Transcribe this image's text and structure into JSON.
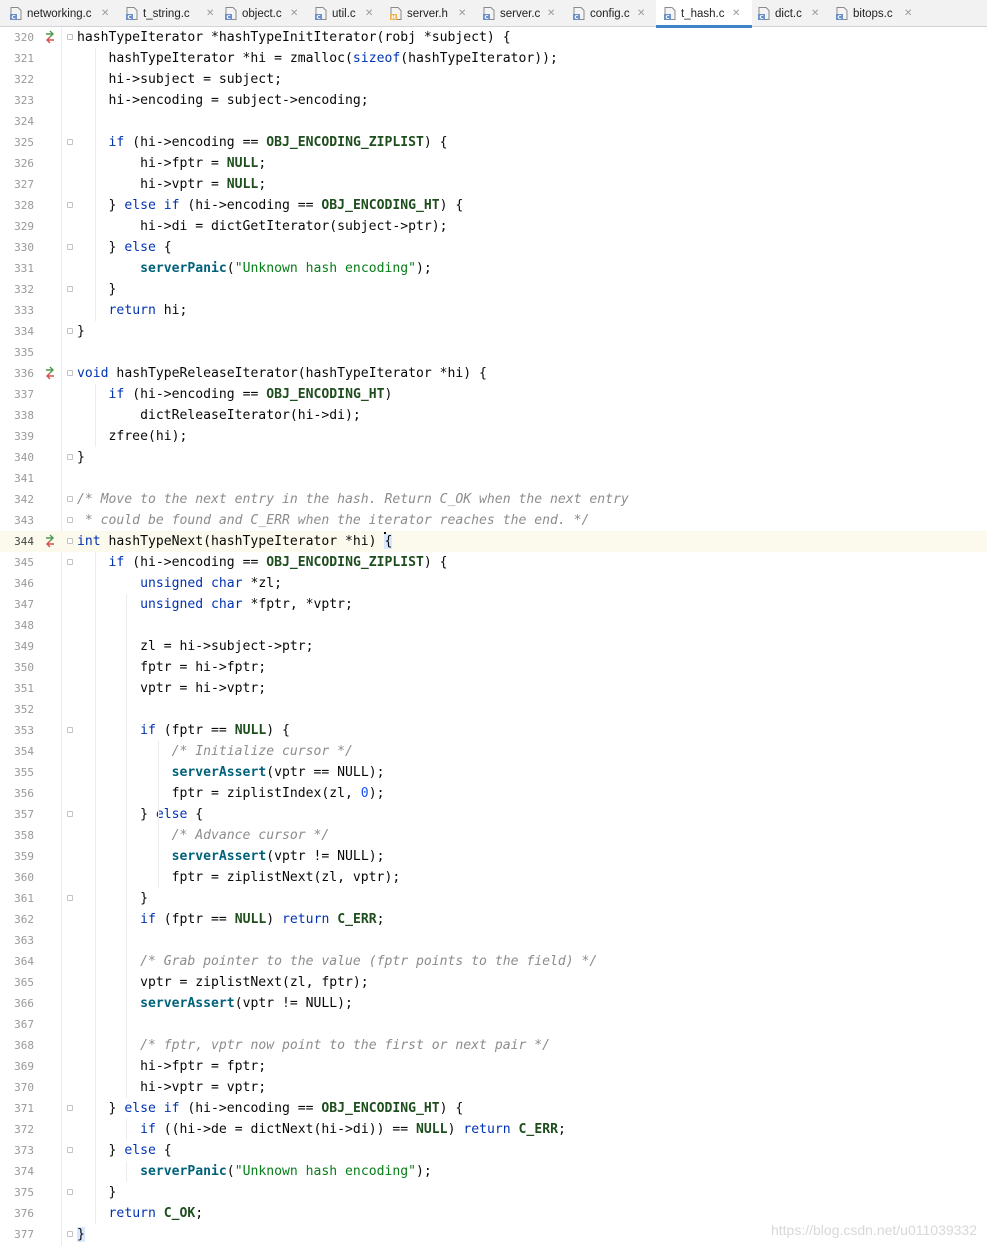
{
  "tabs": [
    {
      "label": "networking.c",
      "type": "c",
      "active": false
    },
    {
      "label": "t_string.c",
      "type": "c",
      "active": false
    },
    {
      "label": "object.c",
      "type": "c",
      "active": false
    },
    {
      "label": "util.c",
      "type": "c",
      "active": false
    },
    {
      "label": "server.h",
      "type": "h",
      "active": false
    },
    {
      "label": "server.c",
      "type": "c",
      "active": false
    },
    {
      "label": "config.c",
      "type": "c",
      "active": false
    },
    {
      "label": "t_hash.c",
      "type": "c",
      "active": true
    },
    {
      "label": "dict.c",
      "type": "c",
      "active": false
    },
    {
      "label": "bitops.c",
      "type": "c",
      "active": false
    }
  ],
  "editor": {
    "current_line": 344,
    "lines": [
      {
        "n": "320",
        "t": [
          [
            "t",
            "hashTypeIterator *hashTypeInitIterator(robj *subject) {"
          ]
        ]
      },
      {
        "n": "321",
        "t": [
          [
            "t",
            "    hashTypeIterator *hi = zmalloc("
          ],
          [
            "k",
            "sizeof"
          ],
          [
            "t",
            "(hashTypeIterator));"
          ]
        ]
      },
      {
        "n": "322",
        "t": [
          [
            "t",
            "    hi->subject = subject;"
          ]
        ]
      },
      {
        "n": "323",
        "t": [
          [
            "t",
            "    hi->encoding = subject->encoding;"
          ]
        ]
      },
      {
        "n": "324",
        "t": []
      },
      {
        "n": "325",
        "t": [
          [
            "t",
            "    "
          ],
          [
            "k",
            "if"
          ],
          [
            "t",
            " (hi->encoding == "
          ],
          [
            "m",
            "OBJ_ENCODING_ZIPLIST"
          ],
          [
            "t",
            ") {"
          ]
        ]
      },
      {
        "n": "326",
        "t": [
          [
            "t",
            "        hi->fptr = "
          ],
          [
            "m",
            "NULL"
          ],
          [
            "t",
            ";"
          ]
        ]
      },
      {
        "n": "327",
        "t": [
          [
            "t",
            "        hi->vptr = "
          ],
          [
            "m",
            "NULL"
          ],
          [
            "t",
            ";"
          ]
        ]
      },
      {
        "n": "328",
        "t": [
          [
            "t",
            "    } "
          ],
          [
            "k",
            "else if"
          ],
          [
            "t",
            " (hi->encoding == "
          ],
          [
            "m",
            "OBJ_ENCODING_HT"
          ],
          [
            "t",
            ") {"
          ]
        ]
      },
      {
        "n": "329",
        "t": [
          [
            "t",
            "        hi->di = dictGetIterator(subject->ptr);"
          ]
        ]
      },
      {
        "n": "330",
        "t": [
          [
            "t",
            "    } "
          ],
          [
            "k",
            "else"
          ],
          [
            "t",
            " {"
          ]
        ]
      },
      {
        "n": "331",
        "t": [
          [
            "t",
            "        "
          ],
          [
            "f",
            "serverPanic"
          ],
          [
            "t",
            "("
          ],
          [
            "s",
            "\"Unknown hash encoding\""
          ],
          [
            "t",
            ");"
          ]
        ]
      },
      {
        "n": "332",
        "t": [
          [
            "t",
            "    }"
          ]
        ]
      },
      {
        "n": "333",
        "t": [
          [
            "t",
            "    "
          ],
          [
            "k",
            "return"
          ],
          [
            "t",
            " hi;"
          ]
        ]
      },
      {
        "n": "334",
        "t": [
          [
            "t",
            "}"
          ]
        ]
      },
      {
        "n": "335",
        "t": []
      },
      {
        "n": "336",
        "t": [
          [
            "k",
            "void"
          ],
          [
            "t",
            " hashTypeReleaseIterator(hashTypeIterator *hi) {"
          ]
        ]
      },
      {
        "n": "337",
        "t": [
          [
            "t",
            "    "
          ],
          [
            "k",
            "if"
          ],
          [
            "t",
            " (hi->encoding == "
          ],
          [
            "m",
            "OBJ_ENCODING_HT"
          ],
          [
            "t",
            ")"
          ]
        ]
      },
      {
        "n": "338",
        "t": [
          [
            "t",
            "        dictReleaseIterator(hi->di);"
          ]
        ]
      },
      {
        "n": "339",
        "t": [
          [
            "t",
            "    zfree(hi);"
          ]
        ]
      },
      {
        "n": "340",
        "t": [
          [
            "t",
            "}"
          ]
        ]
      },
      {
        "n": "341",
        "t": []
      },
      {
        "n": "342",
        "t": [
          [
            "c",
            "/* Move to the next entry in the hash. Return C_OK when the next entry"
          ]
        ]
      },
      {
        "n": "343",
        "t": [
          [
            "c",
            " * could be found and C_ERR when the iterator reaches the end. */"
          ]
        ]
      },
      {
        "n": "344",
        "t": [
          [
            "k",
            "int"
          ],
          [
            "t",
            " hashTypeNext(hashTypeIterator *hi) "
          ],
          [
            "b",
            "{"
          ]
        ]
      },
      {
        "n": "345",
        "t": [
          [
            "t",
            "    "
          ],
          [
            "k",
            "if"
          ],
          [
            "t",
            " (hi->encoding == "
          ],
          [
            "m",
            "OBJ_ENCODING_ZIPLIST"
          ],
          [
            "t",
            ") {"
          ]
        ]
      },
      {
        "n": "346",
        "t": [
          [
            "t",
            "        "
          ],
          [
            "k",
            "unsigned char"
          ],
          [
            "t",
            " *zl;"
          ]
        ]
      },
      {
        "n": "347",
        "t": [
          [
            "t",
            "        "
          ],
          [
            "k",
            "unsigned char"
          ],
          [
            "t",
            " *fptr, *vptr;"
          ]
        ]
      },
      {
        "n": "348",
        "t": []
      },
      {
        "n": "349",
        "t": [
          [
            "t",
            "        zl = hi->subject->ptr;"
          ]
        ]
      },
      {
        "n": "350",
        "t": [
          [
            "t",
            "        fptr = hi->fptr;"
          ]
        ]
      },
      {
        "n": "351",
        "t": [
          [
            "t",
            "        vptr = hi->vptr;"
          ]
        ]
      },
      {
        "n": "352",
        "t": []
      },
      {
        "n": "353",
        "t": [
          [
            "t",
            "        "
          ],
          [
            "k",
            "if"
          ],
          [
            "t",
            " (fptr == "
          ],
          [
            "m",
            "NULL"
          ],
          [
            "t",
            ") {"
          ]
        ]
      },
      {
        "n": "354",
        "t": [
          [
            "t",
            "            "
          ],
          [
            "c",
            "/* Initialize cursor */"
          ]
        ]
      },
      {
        "n": "355",
        "t": [
          [
            "t",
            "            "
          ],
          [
            "f",
            "serverAssert"
          ],
          [
            "t",
            "(vptr == NULL);"
          ]
        ]
      },
      {
        "n": "356",
        "t": [
          [
            "t",
            "            fptr = ziplistIndex(zl, "
          ],
          [
            "n",
            "0"
          ],
          [
            "t",
            ");"
          ]
        ]
      },
      {
        "n": "357",
        "t": [
          [
            "t",
            "        } "
          ],
          [
            "k",
            "else"
          ],
          [
            "t",
            " {"
          ]
        ]
      },
      {
        "n": "358",
        "t": [
          [
            "t",
            "            "
          ],
          [
            "c",
            "/* Advance cursor */"
          ]
        ]
      },
      {
        "n": "359",
        "t": [
          [
            "t",
            "            "
          ],
          [
            "f",
            "serverAssert"
          ],
          [
            "t",
            "(vptr != NULL);"
          ]
        ]
      },
      {
        "n": "360",
        "t": [
          [
            "t",
            "            fptr = ziplistNext(zl, vptr);"
          ]
        ]
      },
      {
        "n": "361",
        "t": [
          [
            "t",
            "        }"
          ]
        ]
      },
      {
        "n": "362",
        "t": [
          [
            "t",
            "        "
          ],
          [
            "k",
            "if"
          ],
          [
            "t",
            " (fptr == "
          ],
          [
            "m",
            "NULL"
          ],
          [
            "t",
            ") "
          ],
          [
            "k",
            "return"
          ],
          [
            "t",
            " "
          ],
          [
            "m",
            "C_ERR"
          ],
          [
            "t",
            ";"
          ]
        ]
      },
      {
        "n": "363",
        "t": []
      },
      {
        "n": "364",
        "t": [
          [
            "t",
            "        "
          ],
          [
            "c",
            "/* Grab pointer to the value (fptr points to the field) */"
          ]
        ]
      },
      {
        "n": "365",
        "t": [
          [
            "t",
            "        vptr = ziplistNext(zl, fptr);"
          ]
        ]
      },
      {
        "n": "366",
        "t": [
          [
            "t",
            "        "
          ],
          [
            "f",
            "serverAssert"
          ],
          [
            "t",
            "(vptr != NULL);"
          ]
        ]
      },
      {
        "n": "367",
        "t": []
      },
      {
        "n": "368",
        "t": [
          [
            "t",
            "        "
          ],
          [
            "c",
            "/* fptr, vptr now point to the first or next pair */"
          ]
        ]
      },
      {
        "n": "369",
        "t": [
          [
            "t",
            "        hi->fptr = fptr;"
          ]
        ]
      },
      {
        "n": "370",
        "t": [
          [
            "t",
            "        hi->vptr = vptr;"
          ]
        ]
      },
      {
        "n": "371",
        "t": [
          [
            "t",
            "    } "
          ],
          [
            "k",
            "else if"
          ],
          [
            "t",
            " (hi->encoding == "
          ],
          [
            "m",
            "OBJ_ENCODING_HT"
          ],
          [
            "t",
            ") {"
          ]
        ]
      },
      {
        "n": "372",
        "t": [
          [
            "t",
            "        "
          ],
          [
            "k",
            "if"
          ],
          [
            "t",
            " ((hi->de = dictNext(hi->di)) == "
          ],
          [
            "m",
            "NULL"
          ],
          [
            "t",
            ") "
          ],
          [
            "k",
            "return"
          ],
          [
            "t",
            " "
          ],
          [
            "m",
            "C_ERR"
          ],
          [
            "t",
            ";"
          ]
        ]
      },
      {
        "n": "373",
        "t": [
          [
            "t",
            "    } "
          ],
          [
            "k",
            "else"
          ],
          [
            "t",
            " {"
          ]
        ]
      },
      {
        "n": "374",
        "t": [
          [
            "t",
            "        "
          ],
          [
            "f",
            "serverPanic"
          ],
          [
            "t",
            "("
          ],
          [
            "s",
            "\"Unknown hash encoding\""
          ],
          [
            "t",
            ");"
          ]
        ]
      },
      {
        "n": "375",
        "t": [
          [
            "t",
            "    }"
          ]
        ]
      },
      {
        "n": "376",
        "t": [
          [
            "t",
            "    "
          ],
          [
            "k",
            "return"
          ],
          [
            "t",
            " "
          ],
          [
            "m",
            "C_OK"
          ],
          [
            "t",
            ";"
          ]
        ]
      },
      {
        "n": "377",
        "t": [
          [
            "b",
            "}"
          ]
        ]
      }
    ],
    "change_marker_lines": [
      "320",
      "336",
      "344"
    ],
    "fold_lines": [
      "320",
      "325",
      "328",
      "330",
      "332",
      "334",
      "336",
      "340",
      "342",
      "343",
      "344",
      "345",
      "353",
      "357",
      "361",
      "371",
      "373",
      "375",
      "377"
    ]
  },
  "watermark": "https://blog.csdn.net/u011039332",
  "colors": {
    "keyword": "#0033b3",
    "function": "#00627a",
    "macro": "#1e4d1e",
    "string": "#067d17",
    "comment": "#8c8c8c",
    "number": "#1750eb",
    "active_tab_underline": "#4083c9"
  }
}
